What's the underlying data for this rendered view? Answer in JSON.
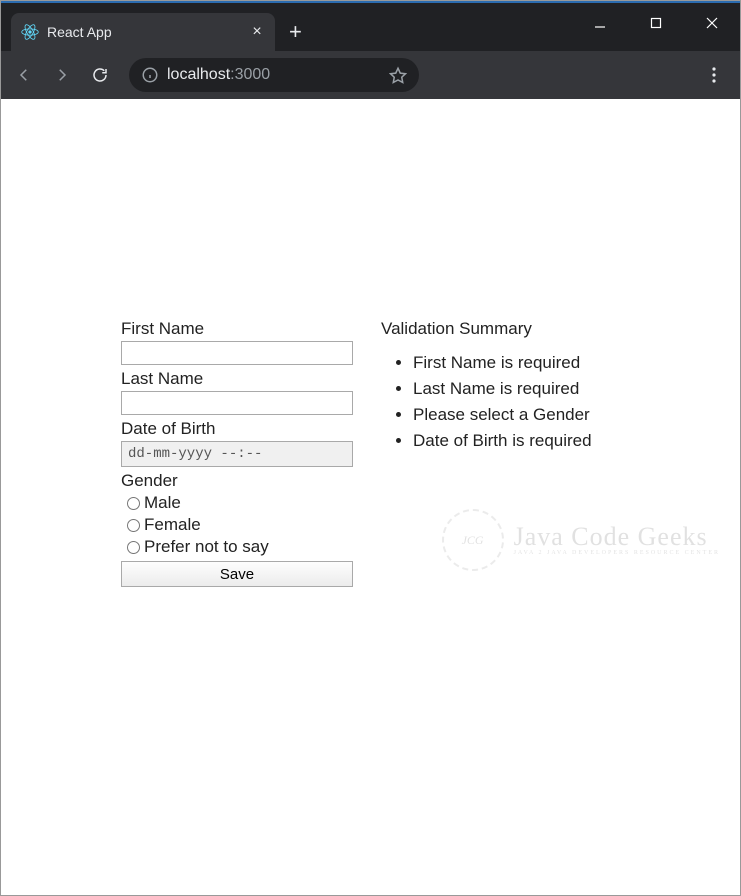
{
  "browser": {
    "tab_title": "React App",
    "url_host": "localhost",
    "url_port": ":3000"
  },
  "form": {
    "first_name_label": "First Name",
    "first_name_value": "",
    "last_name_label": "Last Name",
    "last_name_value": "",
    "dob_label": "Date of Birth",
    "dob_placeholder": "dd-mm-yyyy --:--",
    "gender_label": "Gender",
    "gender_options": {
      "male": "Male",
      "female": "Female",
      "prefer_not": "Prefer not to say"
    },
    "save_label": "Save"
  },
  "validation": {
    "heading": "Validation Summary",
    "items": [
      "First Name is required",
      "Last Name is required",
      "Please select a Gender",
      "Date of Birth is required"
    ]
  },
  "watermark": {
    "badge": "JCG",
    "line1": "Java Code Geeks",
    "line2": "JAVA 2 JAVA DEVELOPERS RESOURCE CENTER"
  }
}
